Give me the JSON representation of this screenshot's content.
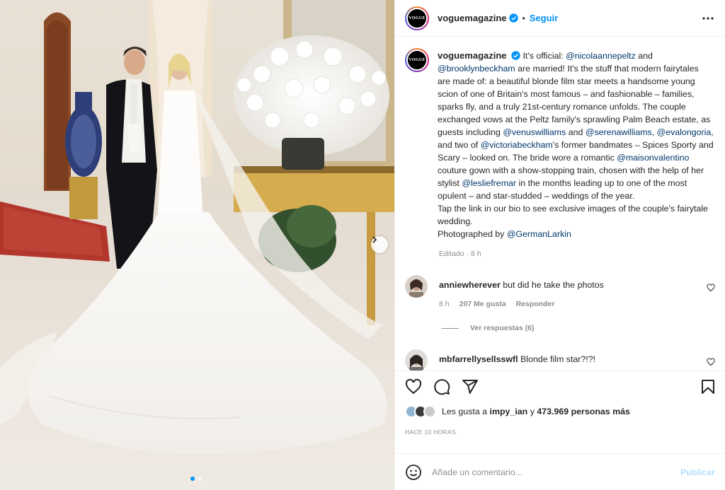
{
  "post": {
    "account": {
      "avatar_text": "VOGUE",
      "username": "voguemagazine",
      "separator": "•",
      "follow_label": "Seguir"
    },
    "caption": {
      "username": "voguemagazine",
      "segments": [
        {
          "t": "It's official: "
        },
        {
          "t": "@nicolaannepeltz",
          "m": true
        },
        {
          "t": " and "
        },
        {
          "t": "@brooklynbeckham",
          "m": true
        },
        {
          "t": " are married! It's the stuff that modern fairytales are made of: a beautiful blonde film star meets a handsome young scion of one of Britain's most famous – and fashionable – families, sparks fly, and a truly 21st-century romance unfolds. The couple exchanged vows at the Peltz family's sprawling Palm Beach estate, as guests including "
        },
        {
          "t": "@venuswilliams",
          "m": true
        },
        {
          "t": " and "
        },
        {
          "t": "@serenawilliams",
          "m": true
        },
        {
          "t": ", "
        },
        {
          "t": "@evalongoria",
          "m": true
        },
        {
          "t": ", and two of "
        },
        {
          "t": "@victoriabeckham",
          "m": true
        },
        {
          "t": "'s former bandmates – Spices Sporty and Scary – looked on. The bride wore a romantic "
        },
        {
          "t": "@maisonvalentino",
          "m": true
        },
        {
          "t": " couture gown with a show-stopping train, chosen with the help of her stylist "
        },
        {
          "t": "@lesliefremar",
          "m": true
        },
        {
          "t": " in the months leading up to one of the most opulent – and star-studded – weddings of the year."
        },
        {
          "br": true
        },
        {
          "t": "Tap the link in our bio to see exclusive images of the couple's fairytale wedding."
        },
        {
          "br": true
        },
        {
          "t": "Photographed by "
        },
        {
          "t": "@GermanLarkin",
          "m": true
        }
      ],
      "meta": "Editado · 8 h"
    },
    "comments": [
      {
        "username": "anniewherever",
        "text": "but did he take the photos",
        "time": "8 h",
        "likes": "207 Me gusta",
        "reply_label": "Responder",
        "view_replies": "Ver respuestas (6)"
      },
      {
        "username": "mbfarrellysellsswfl",
        "text": "Blonde film star?!?!"
      }
    ],
    "likes": {
      "prefix": "Les gusta a",
      "user": "impy_ian",
      "joiner": "y",
      "count": "473.969 personas más"
    },
    "posted_ago": "HACE 10 HORAS",
    "add_comment": {
      "placeholder": "Añade un comentario...",
      "publish_label": "Publicar"
    },
    "carousel": {
      "slide_count": 2,
      "active_index": 0
    },
    "colors": {
      "accent": "#0095f6",
      "mention": "#00376b",
      "muted": "#8e8e8e",
      "publish_disabled": "#b2dffc"
    },
    "icons": [
      "verified-badge-icon",
      "more-options-icon",
      "heart-icon",
      "comment-icon",
      "share-icon",
      "bookmark-icon",
      "emoji-icon",
      "chevron-right-icon"
    ]
  }
}
